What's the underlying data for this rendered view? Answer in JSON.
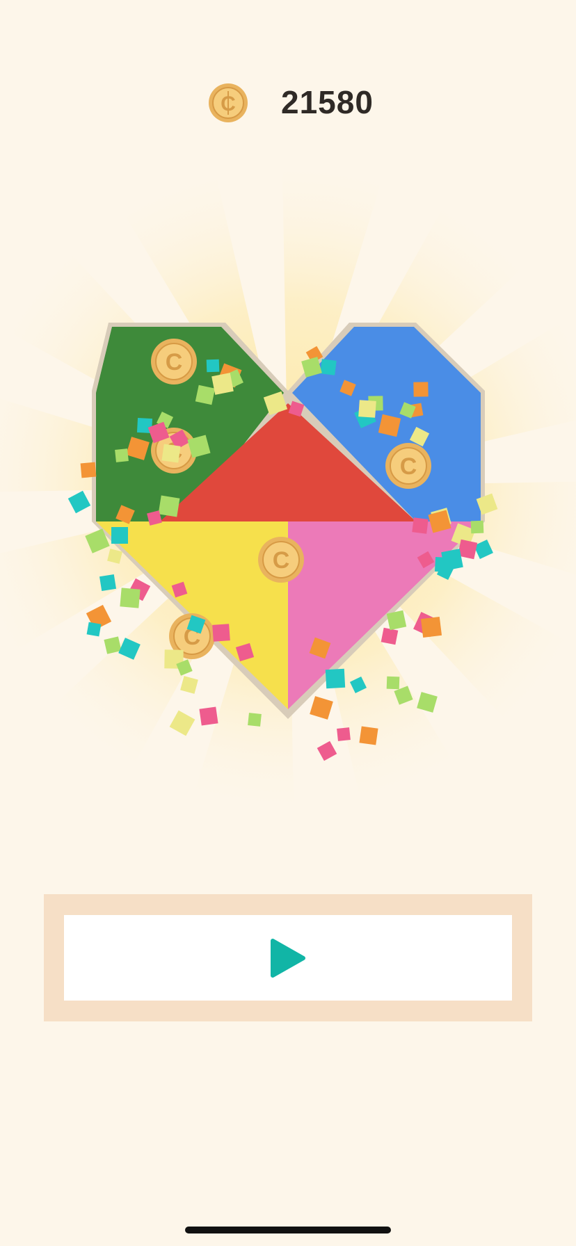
{
  "header": {
    "coin_icon": "coin-icon",
    "coin_count": "21580"
  },
  "puzzle": {
    "shape": "heart",
    "pieces": [
      {
        "name": "green-piece",
        "color": "#3e8a3a"
      },
      {
        "name": "blue-piece",
        "color": "#4a8de6"
      },
      {
        "name": "red-piece",
        "color": "#e0483c"
      },
      {
        "name": "yellow-piece",
        "color": "#f6e04c"
      },
      {
        "name": "pink-piece",
        "color": "#ec7ab8"
      }
    ],
    "outline_color": "#d8ccb9",
    "confetti_colors": [
      "#f39436",
      "#22c7c3",
      "#a8dd69",
      "#ee5c8e",
      "#ece888"
    ]
  },
  "controls": {
    "play_button_icon": "play-icon",
    "accent_color": "#11b5a6"
  }
}
